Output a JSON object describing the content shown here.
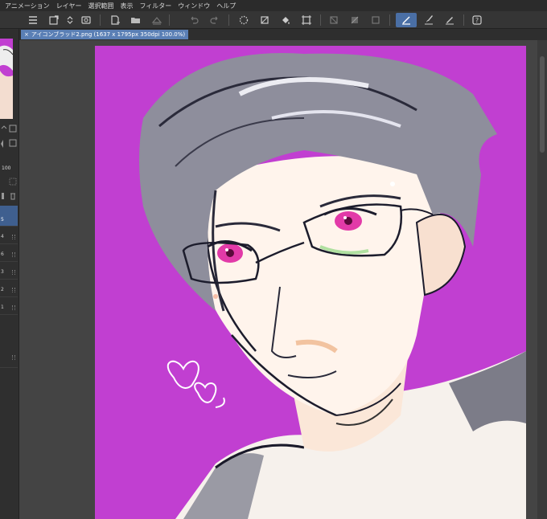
{
  "menu": {
    "items": [
      "アニメーション",
      "レイヤー",
      "選択範囲",
      "表示",
      "フィルター",
      "ウィンドウ",
      "ヘルプ"
    ]
  },
  "tab": {
    "close": "×",
    "title": "アイコンブラッド2.png (1637 x 1795px 350dpi 100.0%)"
  },
  "left_panel": {
    "opacity_value": "100",
    "layer_numbers": [
      "5",
      "4",
      "6",
      "3",
      "2",
      "1"
    ]
  },
  "colors": {
    "canvas_background": "#c13fd1",
    "tab_active": "#5a7fb5",
    "tool_active": "#4a6fa5"
  },
  "toolbar_icons": [
    "menu-icon",
    "new-icon",
    "stepper-icon",
    "settings-icon",
    "new-canvas-icon",
    "open-icon",
    "save-icon",
    "undo-icon",
    "redo-icon",
    "loading-icon",
    "fill-icon",
    "crop-icon",
    "clear-icon",
    "selection-icon",
    "square-icon",
    "pen-ruler-icon",
    "brush-icon",
    "pen-icon",
    "help-icon"
  ]
}
